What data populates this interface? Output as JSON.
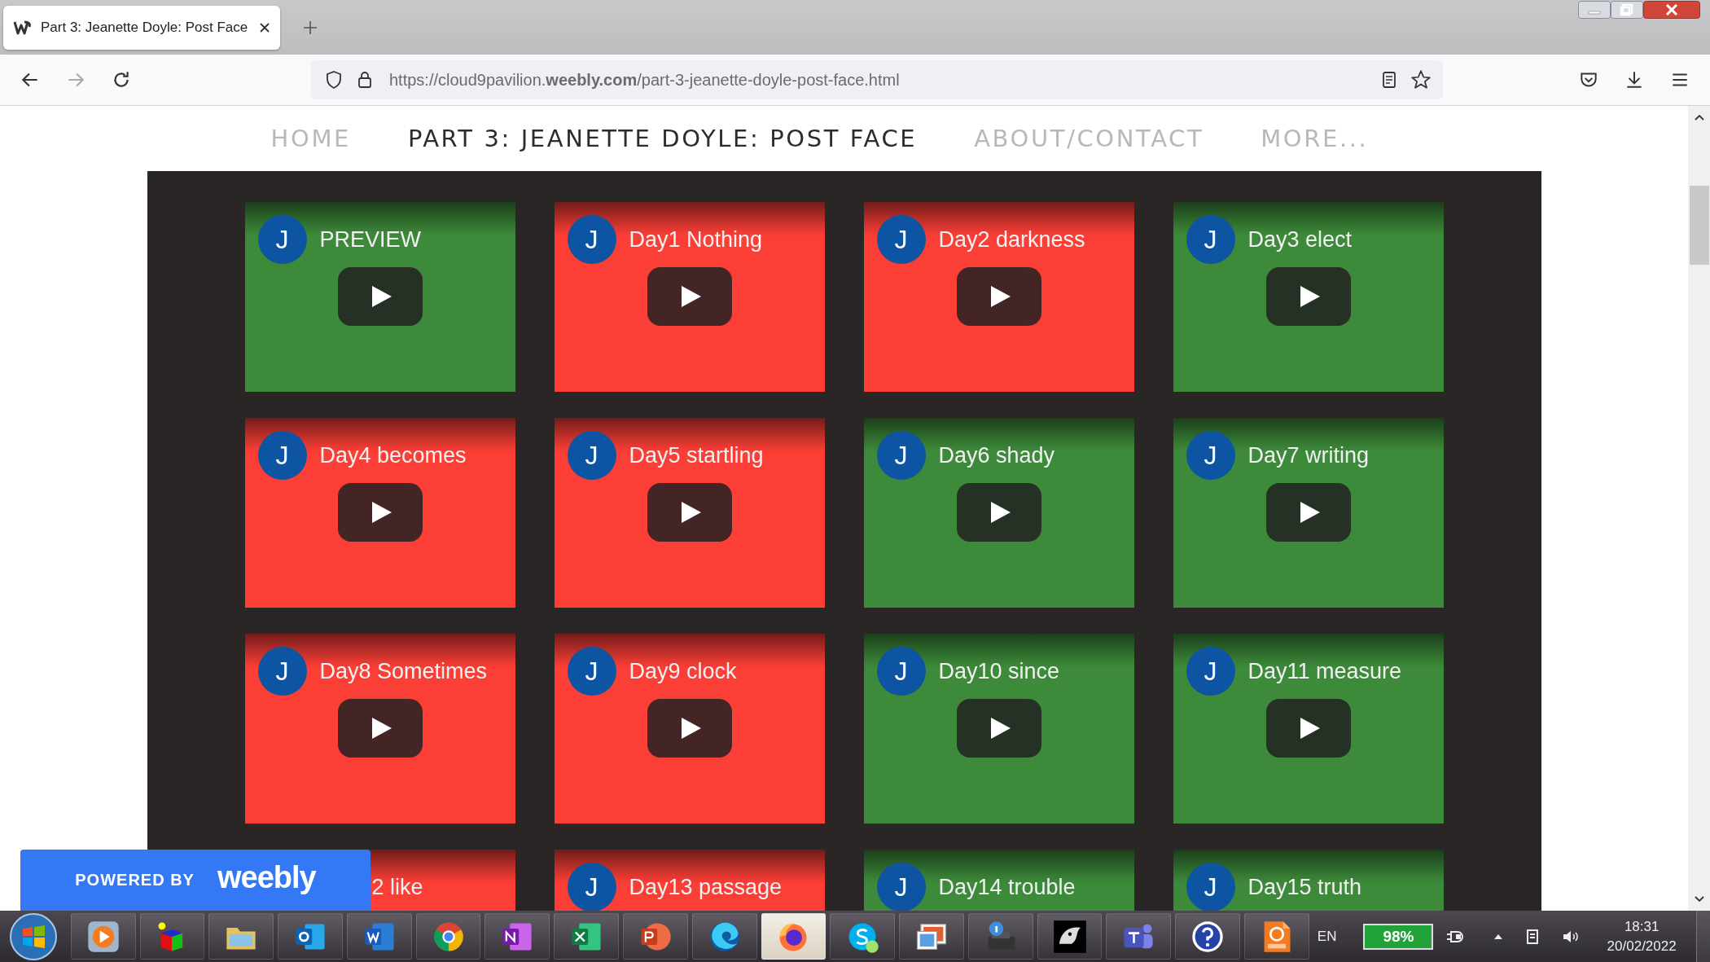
{
  "browser": {
    "tab": {
      "title": "Part 3: Jeanette Doyle: Post Face"
    },
    "url": "https://cloud9pavilion.**weebly.com**/part-3-jeanette-doyle-post-face.html"
  },
  "nav": [
    {
      "label": "HOME",
      "selected": false
    },
    {
      "label": "PART 3: JEANETTE DOYLE: POST FACE",
      "selected": true
    },
    {
      "label": "ABOUT/CONTACT",
      "selected": false
    },
    {
      "label": "MORE...",
      "selected": false
    }
  ],
  "videos": [
    {
      "avatar": "J",
      "title": "PREVIEW",
      "color": "#3d8a3a",
      "play_button": true
    },
    {
      "avatar": "J",
      "title": "Day1 Nothing",
      "color": "#fb3e36",
      "play_button": true
    },
    {
      "avatar": "J",
      "title": "Day2 darkness",
      "color": "#fb3e36",
      "play_button": true
    },
    {
      "avatar": "J",
      "title": "Day3 elect",
      "color": "#3d8a3a",
      "play_button": true
    },
    {
      "avatar": "J",
      "title": "Day4 becomes",
      "color": "#fb3e36",
      "play_button": true
    },
    {
      "avatar": "J",
      "title": "Day5 startling",
      "color": "#fb3e36",
      "play_button": true
    },
    {
      "avatar": "J",
      "title": "Day6 shady",
      "color": "#3d8a3a",
      "play_button": true
    },
    {
      "avatar": "J",
      "title": "Day7 writing",
      "color": "#3d8a3a",
      "play_button": true
    },
    {
      "avatar": "J",
      "title": "Day8 Sometimes",
      "color": "#fb3e36",
      "play_button": true
    },
    {
      "avatar": "J",
      "title": "Day9 clock",
      "color": "#fb3e36",
      "play_button": true
    },
    {
      "avatar": "J",
      "title": "Day10 since",
      "color": "#3d8a3a",
      "play_button": true
    },
    {
      "avatar": "J",
      "title": "Day11 measure",
      "color": "#3d8a3a",
      "play_button": true
    },
    {
      "title": "2 like",
      "color": "#fb3e36",
      "play_button": false
    },
    {
      "avatar": "J",
      "title": "Day13 passage",
      "color": "#fb3e36",
      "play_button": false
    },
    {
      "avatar": "J",
      "title": "Day14 trouble",
      "color": "#3d8a3a",
      "play_button": false
    },
    {
      "avatar": "J",
      "title": "Day15 truth",
      "color": "#3d8a3a",
      "play_button": false
    }
  ],
  "badge": {
    "prefix": "POWERED BY",
    "brand": "weebly"
  },
  "taskbar": {
    "apps": [
      {
        "kind": "media",
        "active": false
      },
      {
        "kind": "cube",
        "active": false
      },
      {
        "kind": "folder",
        "active": false
      },
      {
        "kind": "outlook",
        "active": false
      },
      {
        "kind": "word",
        "active": false
      },
      {
        "kind": "chrome",
        "active": false
      },
      {
        "kind": "onenote",
        "active": false
      },
      {
        "kind": "excel",
        "active": false
      },
      {
        "kind": "powerpoint",
        "active": false
      },
      {
        "kind": "edge",
        "active": false
      },
      {
        "kind": "firefox",
        "active": true
      },
      {
        "kind": "skype",
        "active": false
      },
      {
        "kind": "photos",
        "active": false
      },
      {
        "kind": "printer",
        "active": false
      },
      {
        "kind": "mascot",
        "active": false
      },
      {
        "kind": "teams",
        "active": false
      },
      {
        "kind": "help",
        "active": false
      },
      {
        "kind": "pdf",
        "active": false
      }
    ],
    "language": "EN",
    "battery": "98%",
    "time": "18:31",
    "date": "20/02/2022"
  }
}
